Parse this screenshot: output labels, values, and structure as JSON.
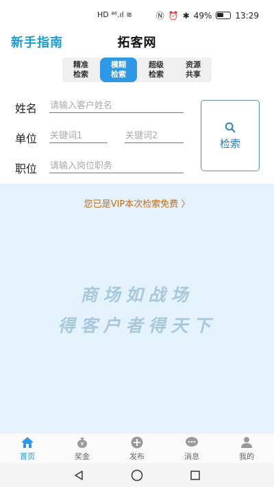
{
  "status_bar": {
    "left_glyphs": "HD ⁴⁶.ıl ≋",
    "battery": "49%",
    "time": "13:29"
  },
  "header": {
    "guide_link": "新手指南",
    "title": "拓客网"
  },
  "tabs": [
    {
      "line1": "精准",
      "line2": "检索",
      "active": false
    },
    {
      "line1": "模糊",
      "line2": "检索",
      "active": true
    },
    {
      "line1": "超级",
      "line2": "检索",
      "active": false
    },
    {
      "line1": "资源",
      "line2": "共享",
      "active": false
    }
  ],
  "form": {
    "name_label": "姓名",
    "name_placeholder": "请输入客户姓名",
    "company_label": "单位",
    "keyword1_placeholder": "关键词1",
    "keyword2_placeholder": "关键词2",
    "position_label": "职位",
    "position_placeholder": "请输入岗位职务",
    "search_button": "检索"
  },
  "content": {
    "vip_note": "您已是VIP本次检索免费 〉",
    "slogan_line1": "商场如战场",
    "slogan_line2": "得客户者得天下"
  },
  "bottom_nav": [
    {
      "label": "首页",
      "icon": "home-icon",
      "active": true
    },
    {
      "label": "奖金",
      "icon": "money-bag-icon",
      "active": false
    },
    {
      "label": "发布",
      "icon": "add-icon",
      "active": false
    },
    {
      "label": "消息",
      "icon": "message-icon",
      "active": false
    },
    {
      "label": "我的",
      "icon": "user-icon",
      "active": false
    }
  ],
  "colors": {
    "accent": "#1a9bd7",
    "tab_active": "#2d98e6",
    "content_bg": "#e3f2fb",
    "vip_text": "#c56a1a"
  }
}
